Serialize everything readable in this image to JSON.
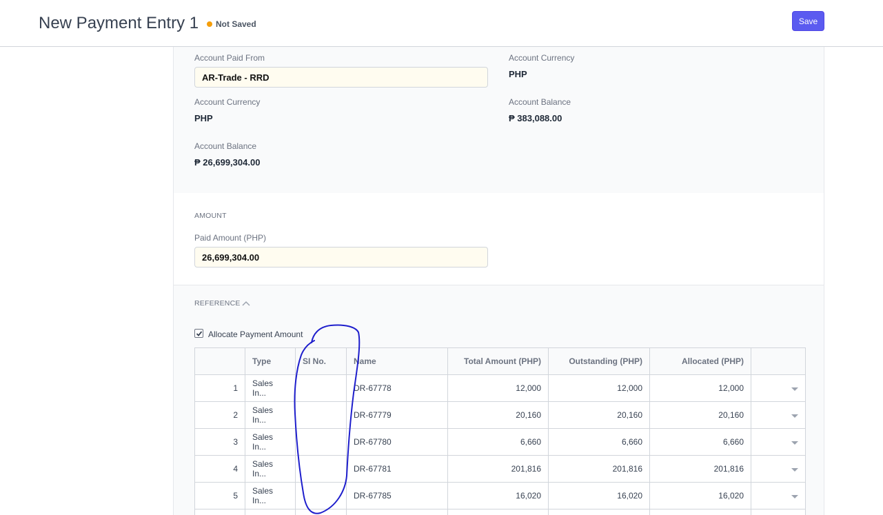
{
  "header": {
    "title": "New Payment Entry 1",
    "status": "Not Saved",
    "status_color": "#f59e0b",
    "save_label": "Save",
    "save_color": "#5b5bf0"
  },
  "account_from": {
    "paid_from_label": "Account Paid From",
    "paid_from_value": "AR-Trade - RRD",
    "currency_label": "Account Currency",
    "currency_value": "PHP",
    "balance_label": "Account Balance",
    "balance_value": "₱ 26,699,304.00"
  },
  "account_to": {
    "currency_label": "Account Currency",
    "currency_value": "PHP",
    "balance_label": "Account Balance",
    "balance_value": "₱ 383,088.00"
  },
  "amount": {
    "section_title": "AMOUNT",
    "paid_amount_label": "Paid Amount (PHP)",
    "paid_amount_value": "26,699,304.00"
  },
  "reference": {
    "section_title": "REFERENCE",
    "allocate_label": "Allocate Payment Amount",
    "allocate_checked": true,
    "columns": [
      "Type",
      "SI No.",
      "Name",
      "Total Amount (PHP)",
      "Outstanding (PHP)",
      "Allocated (PHP)"
    ],
    "rows": [
      {
        "idx": "1",
        "type": "Sales In...",
        "si_no": "",
        "name": "DR-67778",
        "total": "12,000",
        "outstanding": "12,000",
        "allocated": "12,000"
      },
      {
        "idx": "2",
        "type": "Sales In...",
        "si_no": "",
        "name": "DR-67779",
        "total": "20,160",
        "outstanding": "20,160",
        "allocated": "20,160"
      },
      {
        "idx": "3",
        "type": "Sales In...",
        "si_no": "",
        "name": "DR-67780",
        "total": "6,660",
        "outstanding": "6,660",
        "allocated": "6,660"
      },
      {
        "idx": "4",
        "type": "Sales In...",
        "si_no": "",
        "name": "DR-67781",
        "total": "201,816",
        "outstanding": "201,816",
        "allocated": "201,816"
      },
      {
        "idx": "5",
        "type": "Sales In...",
        "si_no": "",
        "name": "DR-67785",
        "total": "16,020",
        "outstanding": "16,020",
        "allocated": "16,020"
      }
    ]
  },
  "annotation_color": "#1e1ecc"
}
